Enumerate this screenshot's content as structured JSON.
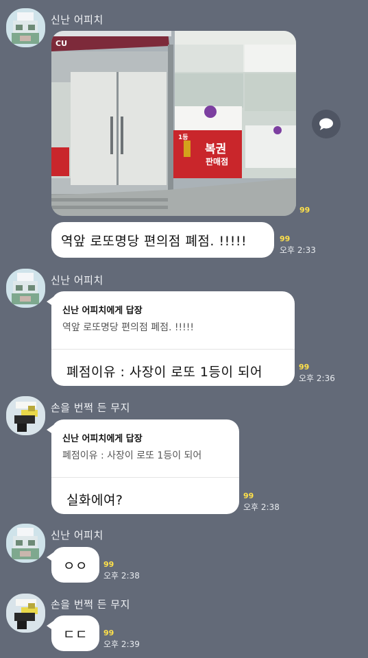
{
  "senders": {
    "apeach": "신난 어피치",
    "muzi": "손을 번쩍 든 무지"
  },
  "icons": {
    "share": "share-speech-icon",
    "avatar_apeach": "apeach-avatar",
    "avatar_muzi": "muzi-avatar"
  },
  "photo": {
    "store_sign": "CU",
    "lottery_sign_main": "복권",
    "lottery_sign_sub": "판매점",
    "first_prize": "1등"
  },
  "messages": {
    "m1": {
      "text": "역앞 로또명당 편의점 폐점. !!!!!",
      "count": "99",
      "time": "오후 2:33"
    },
    "photo_count": "99",
    "m2": {
      "reply_title": "신난 어피치에게 답장",
      "reply_quote": "역앞 로또명당 편의점 폐점. !!!!!",
      "text": "폐점이유 : 사장이 로또 1등이 되어",
      "count": "99",
      "time": "오후 2:36"
    },
    "m3": {
      "reply_title": "신난 어피치에게 답장",
      "reply_quote": "폐점이유 : 사장이 로또 1등이 되어",
      "text": "실화에여?",
      "count": "99",
      "time": "오후 2:38"
    },
    "m4": {
      "text": "ㅇㅇ",
      "count": "99",
      "time": "오후 2:38"
    },
    "m5": {
      "text": "ㄷㄷ",
      "count": "99",
      "time": "오후 2:39"
    }
  },
  "colors": {
    "background": "#636a78",
    "bubble": "#ffffff",
    "unread": "#ffe14a"
  }
}
